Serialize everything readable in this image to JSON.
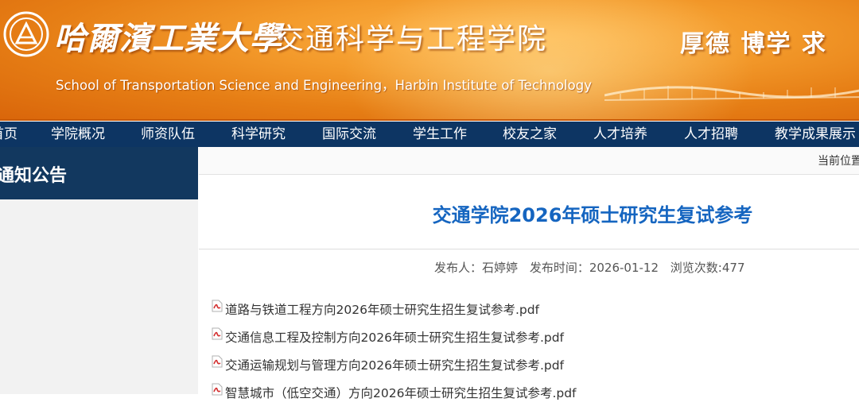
{
  "banner": {
    "university_name": "哈爾濱工業大學",
    "school_name_cn": "交通科学与工程学院",
    "motto": "厚德 博学 求",
    "school_name_en": "School of Transportation Science and Engineering，Harbin Institute of Technology",
    "colors": {
      "primary": "#f39a2b",
      "deep": "#d9650a"
    }
  },
  "nav": {
    "items": [
      "首页",
      "学院概况",
      "师资队伍",
      "科学研究",
      "国际交流",
      "学生工作",
      "校友之家",
      "人才培养",
      "人才招聘",
      "教学成果展示"
    ],
    "color": "#0d3563"
  },
  "sidebar": {
    "title": "通知公告"
  },
  "breadcrumb": {
    "label": "当前位置"
  },
  "article": {
    "title": "交通学院2026年硕士研究生复试参考",
    "publisher_label": "发布人：",
    "publisher": "石婷婷",
    "date_label": "发布时间：",
    "date": "2026-01-12",
    "views_label": "浏览次数:",
    "views": "477",
    "title_color": "#1565c0",
    "attachments": [
      {
        "icon": "pdf-icon",
        "name": "道路与铁道工程方向2026年硕士研究生招生复试参考.pdf"
      },
      {
        "icon": "pdf-icon",
        "name": "交通信息工程及控制方向2026年硕士研究生招生复试参考.pdf"
      },
      {
        "icon": "pdf-icon",
        "name": "交通运输规划与管理方向2026年硕士研究生招生复试参考.pdf"
      },
      {
        "icon": "pdf-icon",
        "name": "智慧城市（低空交通）方向2026年硕士研究生招生复试参考.pdf"
      }
    ]
  }
}
